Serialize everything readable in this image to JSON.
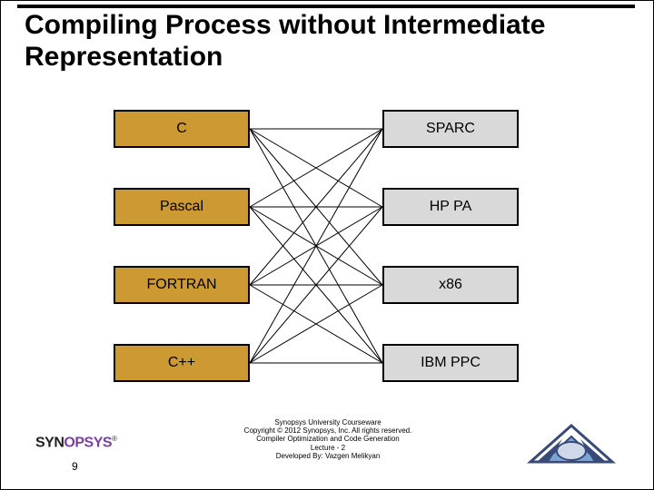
{
  "title": "Compiling Process without Intermediate Representation",
  "left_nodes": [
    "C",
    "Pascal",
    "FORTRAN",
    "C++"
  ],
  "right_nodes": [
    "SPARC",
    "HP PA",
    "x86",
    "IBM PPC"
  ],
  "credits": [
    "Synopsys University Courseware",
    "Copyright © 2012 Synopsys, Inc. All rights reserved.",
    "Compiler Optimization and Code Generation",
    "Lecture - 2",
    "Developed By: Vazgen Melikyan"
  ],
  "page_number": "9",
  "logo_left_part1": "SYNOPSYS",
  "logo_left_tm": "®",
  "chart_data": {
    "type": "diagram",
    "description": "Complete bipartite graph K4,4 between source languages and target architectures",
    "left_set": [
      "C",
      "Pascal",
      "FORTRAN",
      "C++"
    ],
    "right_set": [
      "SPARC",
      "HP PA",
      "x86",
      "IBM PPC"
    ],
    "edges": "every left node connected to every right node (16 edges)"
  }
}
